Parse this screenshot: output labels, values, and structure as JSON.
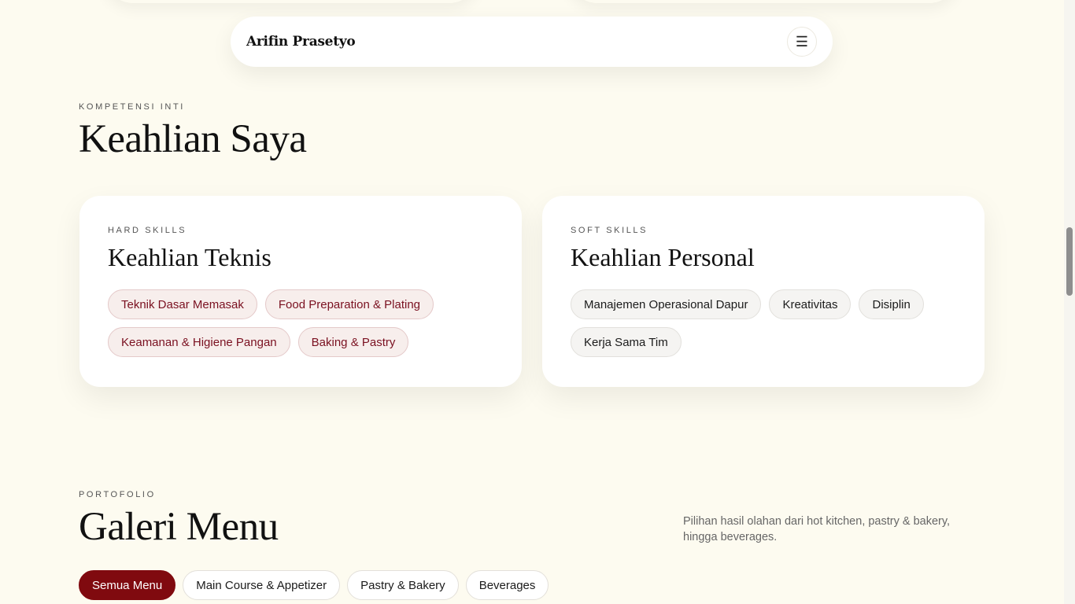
{
  "navbar": {
    "brand": "Arifin Prasetyo",
    "menu_icon": "menu-icon"
  },
  "skills": {
    "eyebrow": "KOMPETENSI INTI",
    "title": "Keahlian Saya",
    "hard": {
      "eyebrow": "HARD SKILLS",
      "title": "Keahlian Teknis",
      "items": [
        "Teknik Dasar Memasak",
        "Food Preparation & Plating",
        "Keamanan & Higiene Pangan",
        "Baking & Pastry"
      ]
    },
    "soft": {
      "eyebrow": "SOFT SKILLS",
      "title": "Keahlian Personal",
      "items": [
        "Manajemen Operasional Dapur",
        "Kreativitas",
        "Disiplin",
        "Kerja Sama Tim"
      ]
    }
  },
  "gallery": {
    "eyebrow": "PORTOFOLIO",
    "title": "Galeri Menu",
    "description": "Pilihan hasil olahan dari hot kitchen, pastry & bakery, hingga beverages.",
    "filters": [
      "Semua Menu",
      "Main Course & Appetizer",
      "Pastry & Bakery",
      "Beverages"
    ],
    "active_filter": "Semua Menu"
  },
  "colors": {
    "background": "#fdfbf0",
    "accent": "#800a0f",
    "hard_chip_bg": "#f7eeec"
  }
}
